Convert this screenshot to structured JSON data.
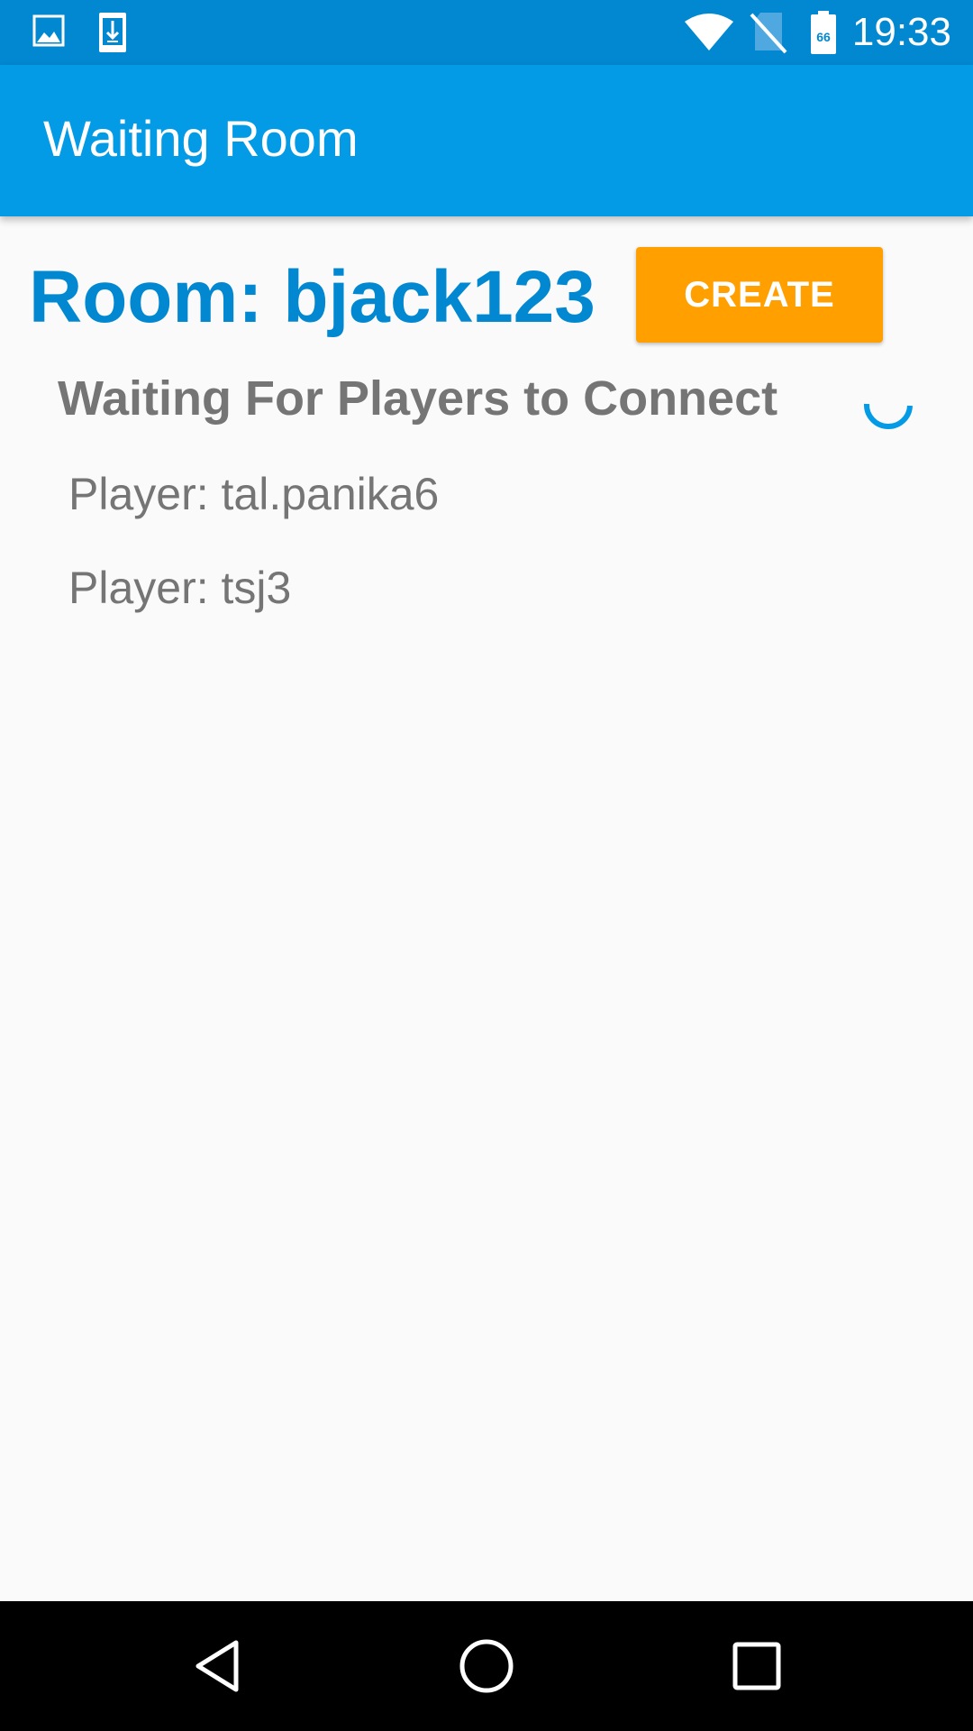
{
  "status_bar": {
    "time": "19:33",
    "battery_level": "66",
    "icons": [
      "image-icon",
      "download-icon",
      "wifi-icon",
      "no-sim-icon",
      "battery-icon"
    ]
  },
  "app_bar": {
    "title": "Waiting Room"
  },
  "room": {
    "title": "Room: bjack123",
    "create_label": "CREATE"
  },
  "waiting": {
    "label": "Waiting For Players to Connect"
  },
  "players": [
    {
      "label": "Player: tal.panika6"
    },
    {
      "label": "Player: tsj3"
    }
  ],
  "nav_bar": {
    "icons": [
      "back-icon",
      "home-icon",
      "recents-icon"
    ]
  },
  "colors": {
    "status_bar": "#0288D1",
    "app_bar": "#039BE5",
    "room_title": "#0288D1",
    "create_button": "#FFA000",
    "secondary_text": "#757575",
    "background": "#FAFAFA"
  }
}
